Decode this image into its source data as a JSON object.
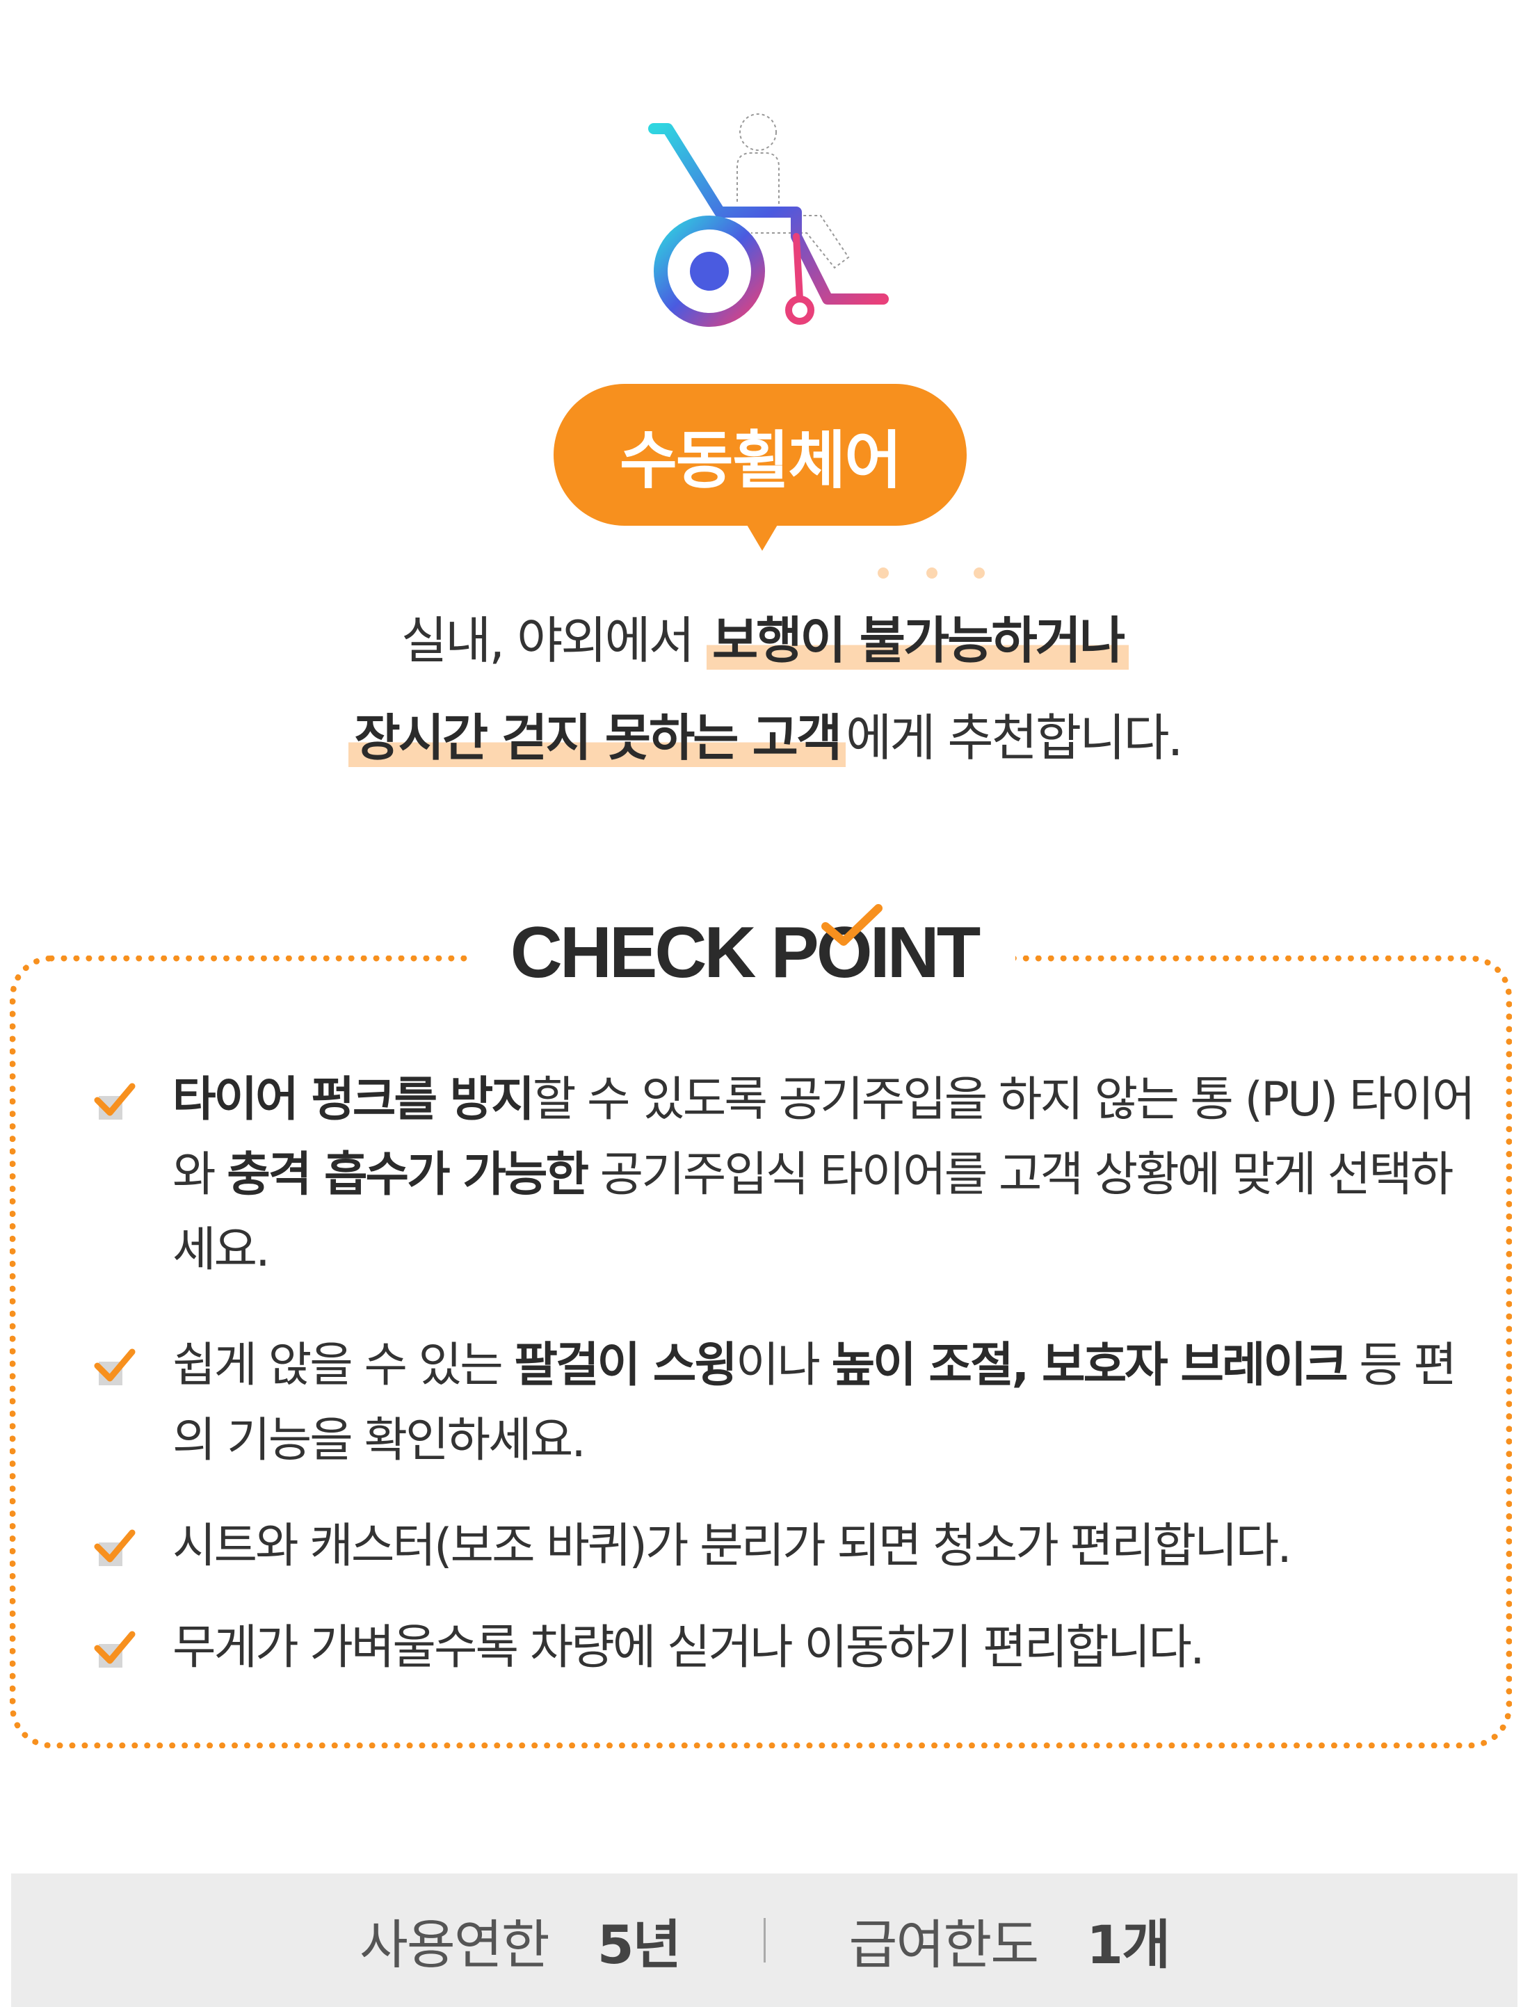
{
  "colors": {
    "accent": "#f7901e",
    "highlight": "#fdd7b0",
    "text": "#333333",
    "footer_bg": "#ececec"
  },
  "icon": {
    "name": "wheelchair-icon"
  },
  "bubble": {
    "label": "수동휠체어"
  },
  "intro": {
    "line1_plain": "실내, 야외에서 ",
    "line1_highlight": "보행이 불가능하거나",
    "line2_highlight": "장시간 걷지 못하는  고객",
    "line2_plain": "에게 추천합니다."
  },
  "checkpoint": {
    "title": "CHECK POINT",
    "items": [
      {
        "parts": [
          {
            "text": "타이어 펑크를 방지",
            "bold": true
          },
          {
            "text": "할 수 있도록 공기주입을 하지 않는 통 (PU) 타이어와 ",
            "bold": false
          },
          {
            "text": "충격 흡수가 가능한",
            "bold": true
          },
          {
            "text": " 공기주입식 타이어를 고객 상황에 맞게 선택하세요.",
            "bold": false
          }
        ]
      },
      {
        "parts": [
          {
            "text": "쉽게 앉을 수 있는 ",
            "bold": false
          },
          {
            "text": "팔걸이 스윙",
            "bold": true
          },
          {
            "text": "이나 ",
            "bold": false
          },
          {
            "text": "높이 조절, 보호자 브레이크",
            "bold": true
          },
          {
            "text": " 등 편의 기능을 확인하세요.",
            "bold": false
          }
        ]
      },
      {
        "parts": [
          {
            "text": "시트와 캐스터(보조 바퀴)가 분리가 되면 청소가 편리합니다.",
            "bold": false
          }
        ]
      },
      {
        "parts": [
          {
            "text": "무게가 가벼울수록 차량에 싣거나 이동하기 편리합니다.",
            "bold": false
          }
        ]
      }
    ]
  },
  "footer": {
    "usage_label": "사용연한",
    "usage_value": "5년",
    "limit_label": "급여한도",
    "limit_value": "1개"
  }
}
